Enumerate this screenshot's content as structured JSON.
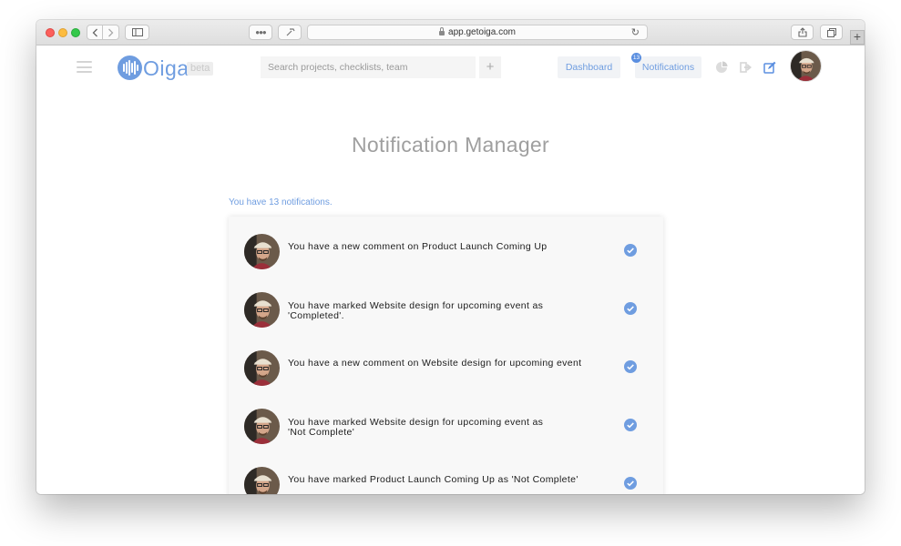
{
  "browser": {
    "url": "app.getoiga.com"
  },
  "header": {
    "logo_text": "Oiga",
    "beta_label": "beta",
    "search_placeholder": "Search projects, checklists, team",
    "add_label": "+",
    "dashboard_label": "Dashboard",
    "notifications_label": "Notifications",
    "notifications_badge": "13",
    "accent_color": "#6f9de0"
  },
  "main": {
    "title": "Notification Manager",
    "count_text": "You have 13 notifications.",
    "notifications": [
      {
        "message": "You have a new comment on Product Launch Coming Up",
        "icon": "check-circle-icon"
      },
      {
        "message": "You have marked Website design for upcoming event as 'Completed'.",
        "icon": "check-circle-icon"
      },
      {
        "message": "You have a new comment on Website design for upcoming event",
        "icon": "check-circle-icon"
      },
      {
        "message": "You have marked Website design for upcoming event as 'Not Complete'",
        "icon": "check-circle-icon"
      },
      {
        "message": "You have marked Product Launch Coming Up as 'Not Complete'",
        "icon": "check-circle-icon"
      }
    ]
  }
}
